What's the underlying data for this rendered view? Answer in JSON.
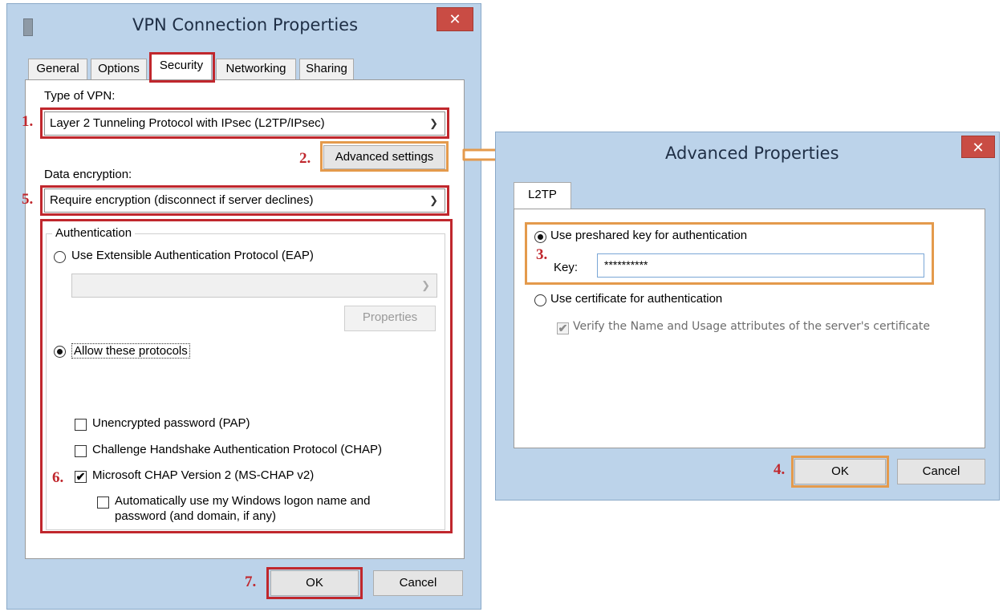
{
  "vpn_dialog": {
    "title": "VPN Connection Properties",
    "close": "✕",
    "tabs": [
      "General",
      "Options",
      "Security",
      "Networking",
      "Sharing"
    ],
    "type_of_vpn_label": "Type of VPN:",
    "type_of_vpn_value": "Layer 2 Tunneling Protocol with IPsec (L2TP/IPsec)",
    "advanced_button": "Advanced settings",
    "data_encryption_label": "Data encryption:",
    "data_encryption_value": "Require encryption (disconnect if server declines)",
    "authentication_group": "Authentication",
    "eap_radio": "Use Extensible Authentication Protocol (EAP)",
    "eap_properties_button": "Properties",
    "allow_protocols_radio": "Allow these protocols",
    "pap_checkbox": "Unencrypted password (PAP)",
    "chap_checkbox": "Challenge Handshake Authentication Protocol (CHAP)",
    "mschap_checkbox": "Microsoft CHAP Version 2 (MS-CHAP v2)",
    "auto_logon_line1": "Automatically use my Windows logon name and",
    "auto_logon_line2": "password (and domain, if any)",
    "ok_button": "OK",
    "cancel_button": "Cancel"
  },
  "advanced_dialog": {
    "title": "Advanced Properties",
    "close": "✕",
    "tab": "L2TP",
    "preshared_radio": "Use preshared key for authentication",
    "key_label": "Key:",
    "key_value": "**********",
    "certificate_radio": "Use certificate for authentication",
    "verify_checkbox": "Verify the Name and Usage attributes of the server's certificate",
    "ok_button": "OK",
    "cancel_button": "Cancel"
  },
  "steps": [
    "1.",
    "2.",
    "3.",
    "4.",
    "5.",
    "6.",
    "7."
  ],
  "colors": {
    "highlight_red": "#c0272d",
    "highlight_orange": "#e49a4c",
    "frame": "#bcd3ea"
  }
}
